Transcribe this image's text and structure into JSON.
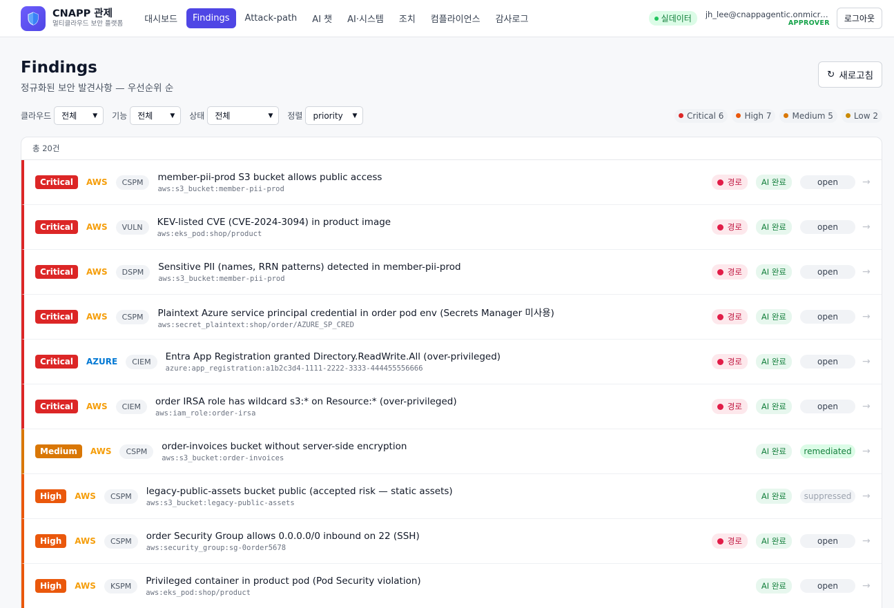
{
  "header": {
    "brand_title": "CNAPP 관제",
    "brand_sub": "멀티클라우드 보안 플랫폼",
    "nav": [
      "대시보드",
      "Findings",
      "Attack-path",
      "AI 챗",
      "AI·시스템",
      "조치",
      "컴플라이언스",
      "감사로그"
    ],
    "nav_active": 1,
    "live_label": "실데이터",
    "user_email": "jh_lee@cnappagentic.onmicrosoft.com",
    "user_role": "APPROVER",
    "logout_label": "로그아웃"
  },
  "page": {
    "title": "Findings",
    "subtitle": "정규화된 보안 발견사항 — 우선순위 순",
    "refresh_label": "새로고침"
  },
  "filters": [
    {
      "label": "클라우드",
      "value": "전체"
    },
    {
      "label": "기능",
      "value": "전체"
    },
    {
      "label": "상태",
      "value": "전체"
    },
    {
      "label": "정렬",
      "value": "priority"
    }
  ],
  "legend": [
    {
      "label": "Critical 6",
      "color": "#dc2626"
    },
    {
      "label": "High 7",
      "color": "#ea580c"
    },
    {
      "label": "Medium 5",
      "color": "#d97706"
    },
    {
      "label": "Low 2",
      "color": "#ca8a04"
    }
  ],
  "table": {
    "total_label": "총 20건",
    "path_label": "경로",
    "ai_label": "AI 완료",
    "colors": {
      "Critical": "#dc2626",
      "High": "#ea580c",
      "Medium": "#d97706",
      "AWS": "#f59e0b",
      "AZURE": "#0078d4"
    },
    "rows": [
      {
        "severity": "Critical",
        "cloud": "AWS",
        "category": "CSPM",
        "title": "member-pii-prod S3 bucket allows public access",
        "resource": "aws:s3_bucket:member-pii-prod",
        "path": true,
        "status": "open"
      },
      {
        "severity": "Critical",
        "cloud": "AWS",
        "category": "VULN",
        "title": "KEV-listed CVE (CVE-2024-3094) in product image",
        "resource": "aws:eks_pod:shop/product",
        "path": true,
        "status": "open"
      },
      {
        "severity": "Critical",
        "cloud": "AWS",
        "category": "DSPM",
        "title": "Sensitive PII (names, RRN patterns) detected in member-pii-prod",
        "resource": "aws:s3_bucket:member-pii-prod",
        "path": true,
        "status": "open"
      },
      {
        "severity": "Critical",
        "cloud": "AWS",
        "category": "CSPM",
        "title": "Plaintext Azure service principal credential in order pod env (Secrets Manager 미사용)",
        "resource": "aws:secret_plaintext:shop/order/AZURE_SP_CRED",
        "path": true,
        "status": "open"
      },
      {
        "severity": "Critical",
        "cloud": "AZURE",
        "category": "CIEM",
        "title": "Entra App Registration granted Directory.ReadWrite.All (over-privileged)",
        "resource": "azure:app_registration:a1b2c3d4-1111-2222-3333-444455556666",
        "path": true,
        "status": "open"
      },
      {
        "severity": "Critical",
        "cloud": "AWS",
        "category": "CIEM",
        "title": "order IRSA role has wildcard s3:* on Resource:* (over-privileged)",
        "resource": "aws:iam_role:order-irsa",
        "path": true,
        "status": "open"
      },
      {
        "severity": "Medium",
        "cloud": "AWS",
        "category": "CSPM",
        "title": "order-invoices bucket without server-side encryption",
        "resource": "aws:s3_bucket:order-invoices",
        "path": false,
        "status": "remediated"
      },
      {
        "severity": "High",
        "cloud": "AWS",
        "category": "CSPM",
        "title": "legacy-public-assets bucket public (accepted risk — static assets)",
        "resource": "aws:s3_bucket:legacy-public-assets",
        "path": false,
        "status": "suppressed"
      },
      {
        "severity": "High",
        "cloud": "AWS",
        "category": "CSPM",
        "title": "order Security Group allows 0.0.0.0/0 inbound on 22 (SSH)",
        "resource": "aws:security_group:sg-0order5678",
        "path": true,
        "status": "open"
      },
      {
        "severity": "High",
        "cloud": "AWS",
        "category": "KSPM",
        "title": "Privileged container in product pod (Pod Security violation)",
        "resource": "aws:eks_pod:shop/product",
        "path": false,
        "status": "open"
      }
    ]
  }
}
